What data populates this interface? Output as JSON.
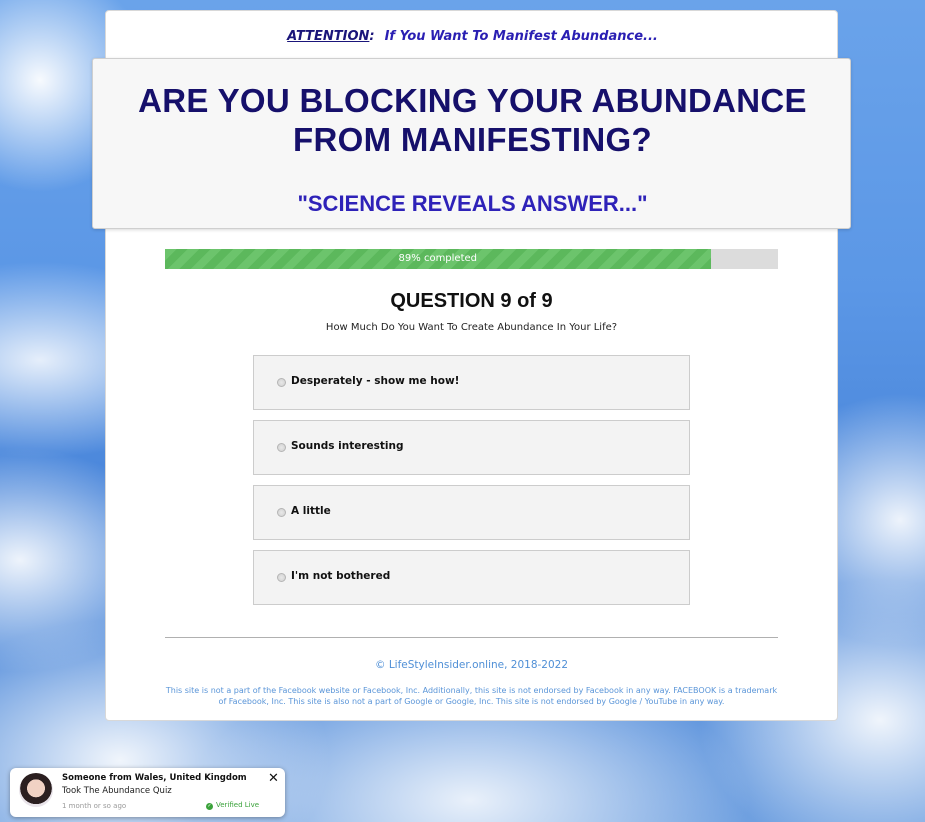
{
  "header": {
    "attention_word": "ATTENTION",
    "attention_colon": ":",
    "attention_text": "If You Want To Manifest Abundance..."
  },
  "headline": {
    "line1": "ARE YOU BLOCKING YOUR ABUNDANCE",
    "line2": "FROM MANIFESTING?",
    "subhead": "\"SCIENCE REVEALS ANSWER...\""
  },
  "progress": {
    "percent": 89,
    "label": "89% completed",
    "fill_color": "#5cb85c"
  },
  "question": {
    "title": "QUESTION 9 of 9",
    "text": "How Much Do You Want To Create Abundance In Your Life?",
    "options": [
      {
        "label": "Desperately - show me how!"
      },
      {
        "label": "Sounds interesting"
      },
      {
        "label": "A little"
      },
      {
        "label": "I'm not bothered"
      }
    ]
  },
  "footer": {
    "copyright": "© LifeStyleInsider.online, 2018-2022",
    "disclaimer_line1": "This site is not a part of the Facebook website or Facebook, Inc. Additionally, this site is not endorsed by Facebook in any way. FACEBOOK is a trademark",
    "disclaimer_line2": "of Facebook, Inc. This site is also not a part of Google or Google, Inc. This site is not endorsed by Google / YouTube in any way."
  },
  "notification": {
    "who": "Someone from Wales, United Kingdom",
    "action": "Took The Abundance Quiz",
    "time": "1 month or so ago",
    "verified": "Verified Live",
    "close_glyph": "✕",
    "avatar_icon": "person-avatar",
    "check_icon": "check-circle-icon"
  },
  "colors": {
    "headline": "#16106b",
    "subhead": "#2e22b8",
    "accent_link": "#4f8fd6",
    "verified": "#3aa23a"
  }
}
